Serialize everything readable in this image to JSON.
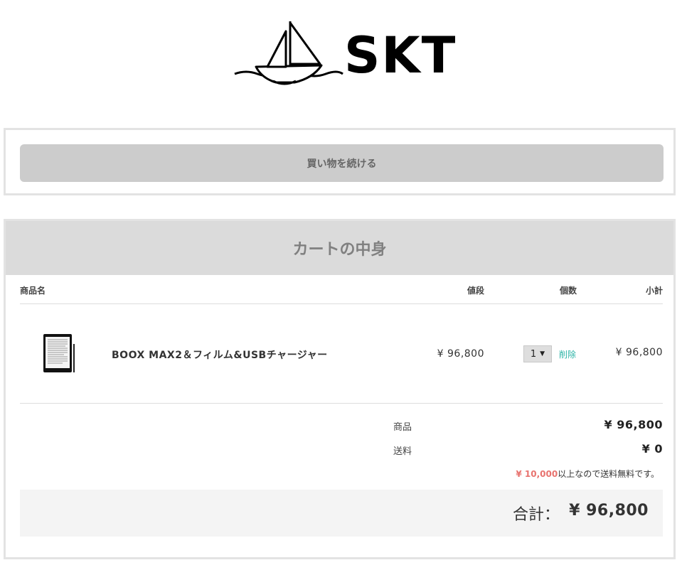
{
  "brand": {
    "logo_text": "SKT",
    "logo_icon": "sailboat-icon"
  },
  "continue_shopping": {
    "label": "買い物を続ける"
  },
  "cart": {
    "title": "カートの中身",
    "columns": {
      "name": "商品名",
      "price": "値段",
      "quantity": "個数",
      "subtotal": "小計"
    },
    "items": [
      {
        "name": "BOOX MAX2＆フィルム&USBチャージャー",
        "price": "¥ 96,800",
        "quantity": "1",
        "delete_label": "削除",
        "subtotal": "¥ 96,800",
        "thumbnail_icon": "ereader-icon"
      }
    ],
    "summary": {
      "products_label": "商品",
      "products_value": "¥ 96,800",
      "shipping_label": "送料",
      "shipping_value": "¥ 0",
      "free_shipping_amount": "¥ 10,000",
      "free_shipping_text": "以上なので送料無料です。",
      "total_label": "合計：",
      "total_value": "¥ 96,800"
    }
  },
  "colors": {
    "delete_link": "#2bb3a6",
    "free_shipping_amount": "#e8736f",
    "header_bg": "#dbdbdb",
    "button_bg": "#cccccc"
  }
}
